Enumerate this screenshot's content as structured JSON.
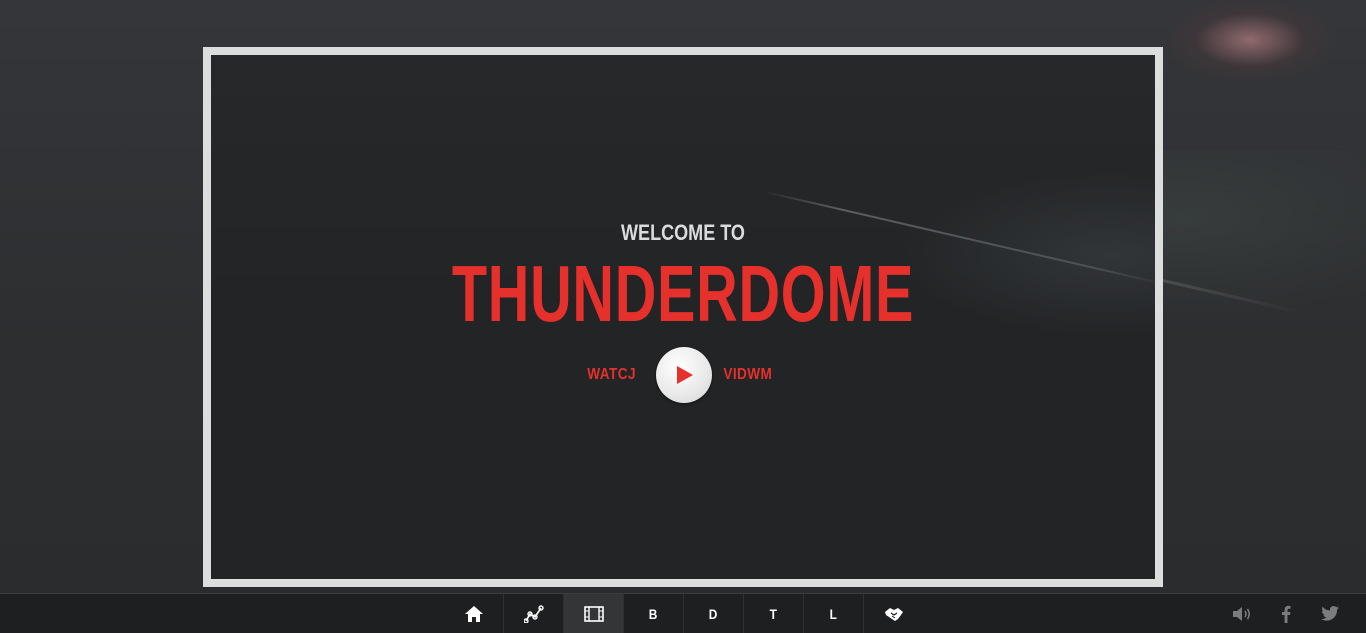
{
  "hero": {
    "welcome_text": "WELCOME TO",
    "title": "THUNDERDOME",
    "watch_left_label": "WATCJ",
    "watch_right_label": "VIDWM",
    "play_icon": "play-icon"
  },
  "nav": {
    "items": [
      {
        "name": "home",
        "icon": "home-icon",
        "label": ""
      },
      {
        "name": "graph",
        "icon": "line-graph-icon",
        "label": ""
      },
      {
        "name": "video",
        "icon": "film-icon",
        "label": "",
        "active": true
      },
      {
        "name": "b",
        "icon": "",
        "label": "B"
      },
      {
        "name": "d",
        "icon": "",
        "label": "D"
      },
      {
        "name": "t",
        "icon": "",
        "label": "T"
      },
      {
        "name": "l",
        "icon": "",
        "label": "L"
      },
      {
        "name": "handshake",
        "icon": "handshake-icon",
        "label": ""
      }
    ]
  },
  "social": {
    "icons": [
      "volume-icon",
      "facebook-icon",
      "twitter-icon"
    ]
  },
  "colors": {
    "accent_red": "#e6302b",
    "frame_border": "#dcdedd",
    "bar_bg": "#1e1f20",
    "icon_grey": "#7a7c7e"
  }
}
